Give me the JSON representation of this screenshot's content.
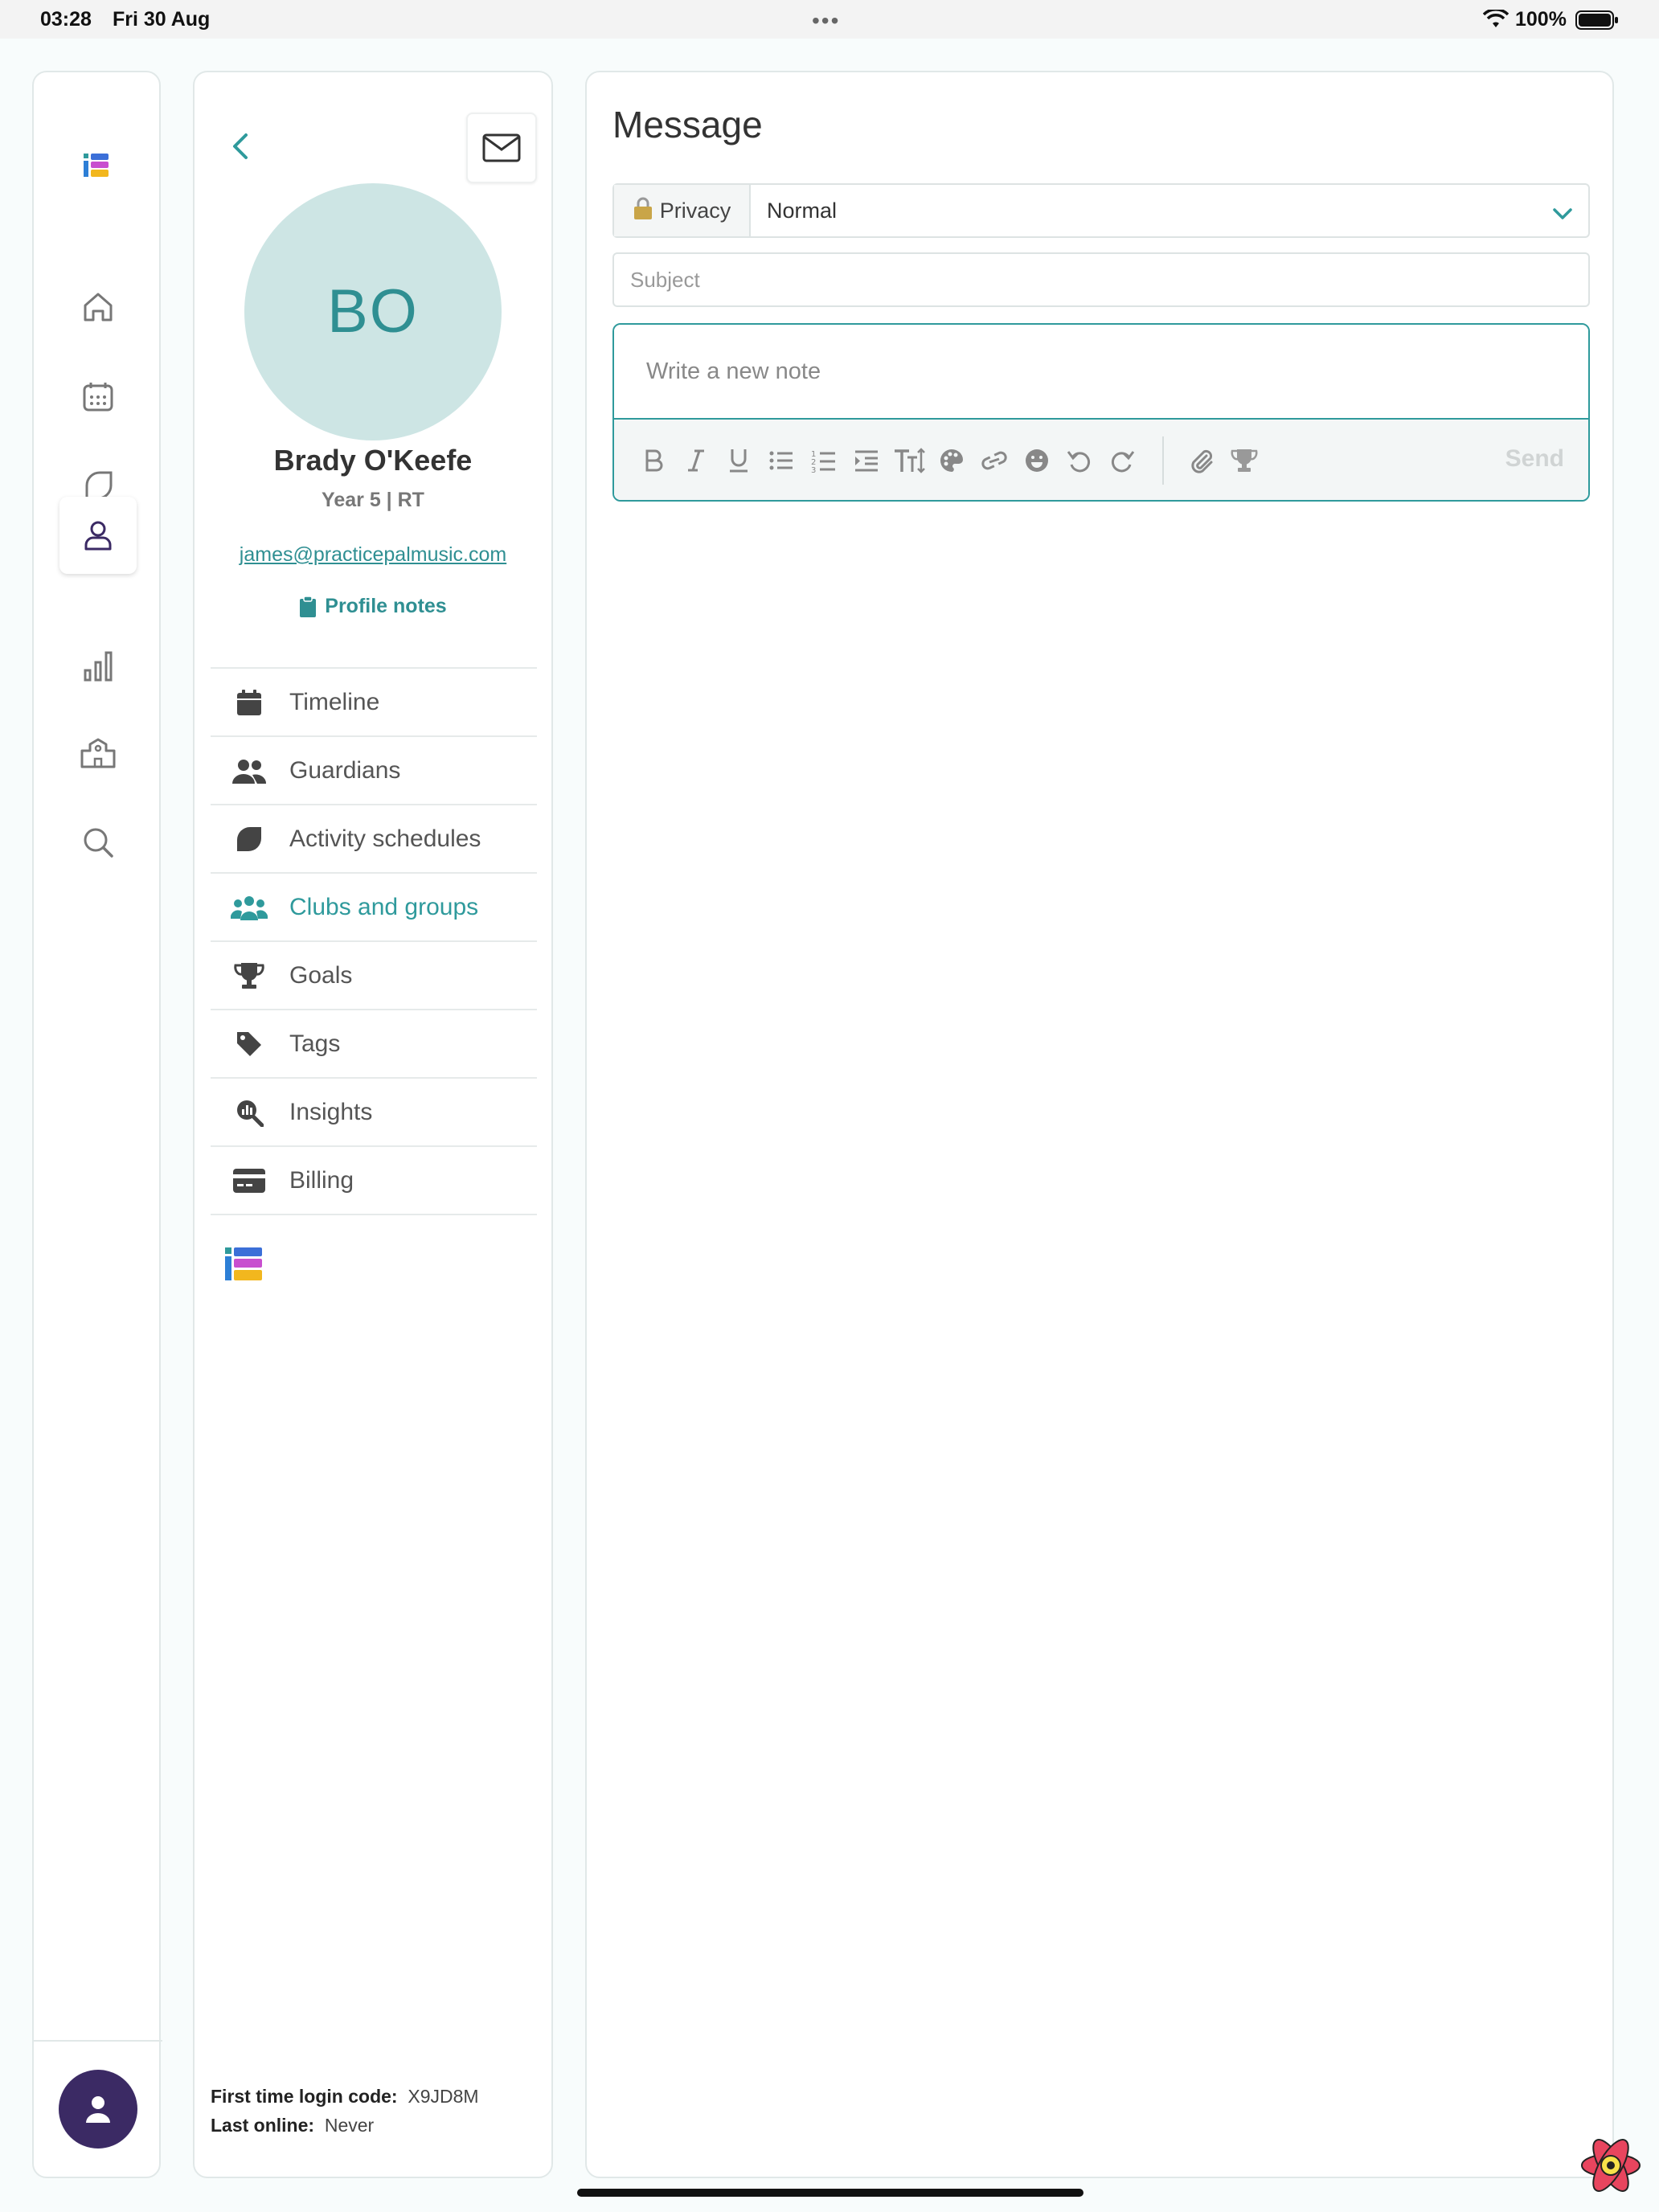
{
  "status_bar": {
    "time": "03:28",
    "date": "Fri 30 Aug",
    "dots": "•••",
    "battery": "100%"
  },
  "nav_rail": {
    "items": [
      {
        "icon": "home-icon"
      },
      {
        "icon": "calendar-icon"
      },
      {
        "icon": "leaf-icon"
      },
      {
        "icon": "person-icon",
        "active": true
      },
      {
        "icon": "bar-chart-icon"
      },
      {
        "icon": "school-icon"
      },
      {
        "icon": "search-icon"
      }
    ]
  },
  "profile": {
    "initials": "BO",
    "name": "Brady O'Keefe",
    "subtitle": "Year 5 | RT",
    "email": "james@practicepalmusic.com",
    "notes_link": "Profile notes",
    "menu": [
      {
        "label": "Timeline",
        "icon": "calendar-icon"
      },
      {
        "label": "Guardians",
        "icon": "users-icon"
      },
      {
        "label": "Activity schedules",
        "icon": "leaf-icon"
      },
      {
        "label": "Clubs and groups",
        "icon": "group-icon",
        "active": true
      },
      {
        "label": "Goals",
        "icon": "trophy-icon"
      },
      {
        "label": "Tags",
        "icon": "tag-icon"
      },
      {
        "label": "Insights",
        "icon": "insights-icon"
      },
      {
        "label": "Billing",
        "icon": "credit-card-icon"
      }
    ],
    "footer": {
      "login_code_label": "First time login code:",
      "login_code_value": "X9JD8M",
      "last_online_label": "Last online:",
      "last_online_value": "Never"
    }
  },
  "message": {
    "title": "Message",
    "privacy_label": "Privacy",
    "privacy_value": "Normal",
    "subject_placeholder": "Subject",
    "note_placeholder": "Write a new note",
    "send_label": "Send"
  },
  "colors": {
    "accent": "#2f9a9c",
    "avatar_bg": "#cde5e4",
    "rail_avatar": "#3b2a64"
  }
}
